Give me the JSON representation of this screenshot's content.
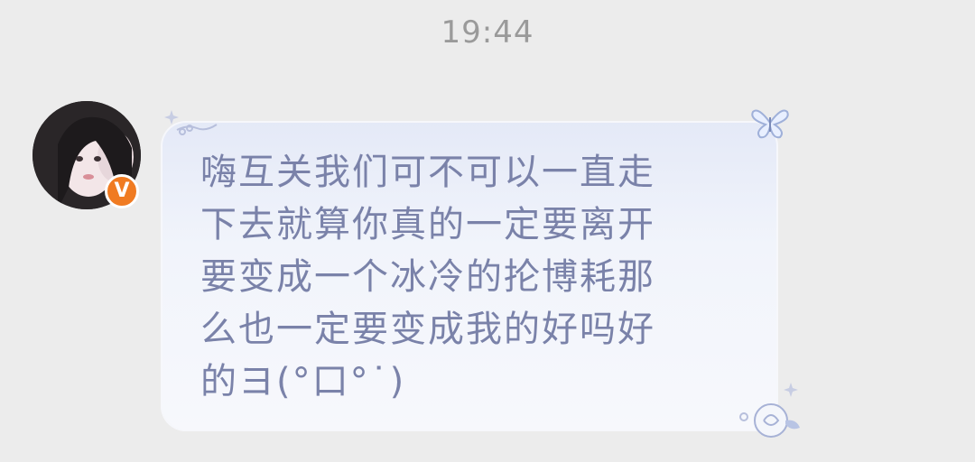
{
  "chat": {
    "timestamp": "19:44",
    "message": {
      "sender_badge": "V",
      "text": "嗨互关我们可不可以一直走\n下去就算你真的一定要离开\n要变成一个冰冷的抡博耗那\n么也一定要变成我的好吗好\n的ヨ(°口°˙)",
      "text_color": "#7a82a9",
      "bubble_color": "#eef1fa"
    }
  },
  "icons": {
    "avatar": "avatar-photo",
    "badge": "verified-icon",
    "butterfly": "butterfly-icon",
    "flower": "rose-icon",
    "sparkle": "sparkle-icon"
  }
}
